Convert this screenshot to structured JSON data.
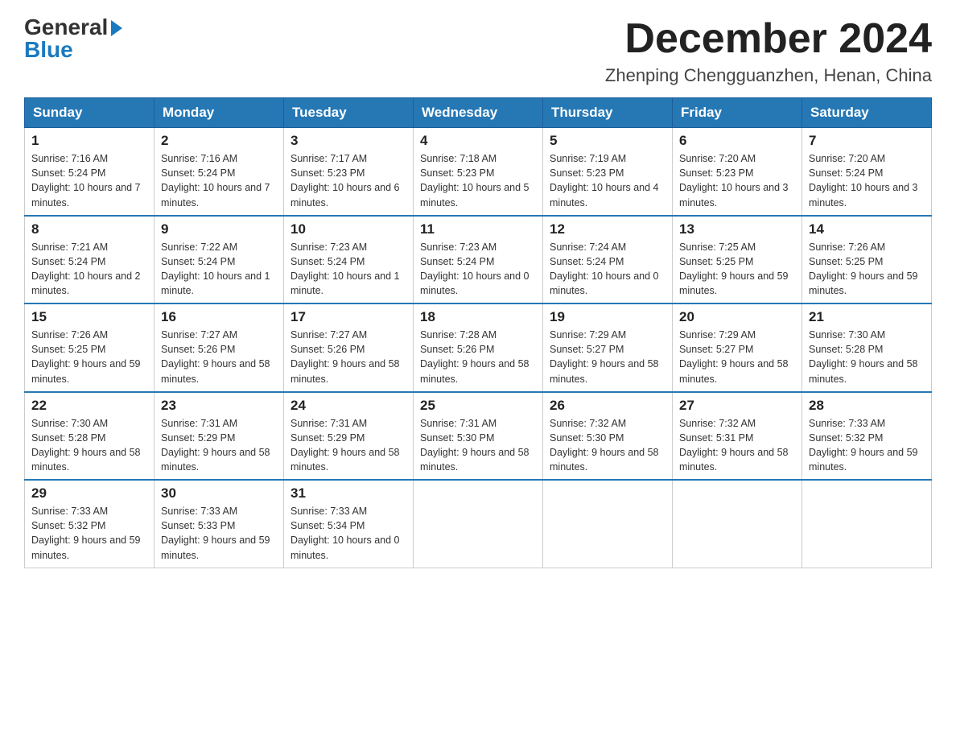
{
  "logo": {
    "text_general": "General",
    "text_blue": "Blue",
    "line2": "Blue"
  },
  "title": "December 2024",
  "subtitle": "Zhenping Chengguanzhen, Henan, China",
  "weekdays": [
    "Sunday",
    "Monday",
    "Tuesday",
    "Wednesday",
    "Thursday",
    "Friday",
    "Saturday"
  ],
  "weeks": [
    [
      {
        "day": "1",
        "sunrise": "7:16 AM",
        "sunset": "5:24 PM",
        "daylight": "10 hours and 7 minutes."
      },
      {
        "day": "2",
        "sunrise": "7:16 AM",
        "sunset": "5:24 PM",
        "daylight": "10 hours and 7 minutes."
      },
      {
        "day": "3",
        "sunrise": "7:17 AM",
        "sunset": "5:23 PM",
        "daylight": "10 hours and 6 minutes."
      },
      {
        "day": "4",
        "sunrise": "7:18 AM",
        "sunset": "5:23 PM",
        "daylight": "10 hours and 5 minutes."
      },
      {
        "day": "5",
        "sunrise": "7:19 AM",
        "sunset": "5:23 PM",
        "daylight": "10 hours and 4 minutes."
      },
      {
        "day": "6",
        "sunrise": "7:20 AM",
        "sunset": "5:23 PM",
        "daylight": "10 hours and 3 minutes."
      },
      {
        "day": "7",
        "sunrise": "7:20 AM",
        "sunset": "5:24 PM",
        "daylight": "10 hours and 3 minutes."
      }
    ],
    [
      {
        "day": "8",
        "sunrise": "7:21 AM",
        "sunset": "5:24 PM",
        "daylight": "10 hours and 2 minutes."
      },
      {
        "day": "9",
        "sunrise": "7:22 AM",
        "sunset": "5:24 PM",
        "daylight": "10 hours and 1 minute."
      },
      {
        "day": "10",
        "sunrise": "7:23 AM",
        "sunset": "5:24 PM",
        "daylight": "10 hours and 1 minute."
      },
      {
        "day": "11",
        "sunrise": "7:23 AM",
        "sunset": "5:24 PM",
        "daylight": "10 hours and 0 minutes."
      },
      {
        "day": "12",
        "sunrise": "7:24 AM",
        "sunset": "5:24 PM",
        "daylight": "10 hours and 0 minutes."
      },
      {
        "day": "13",
        "sunrise": "7:25 AM",
        "sunset": "5:25 PM",
        "daylight": "9 hours and 59 minutes."
      },
      {
        "day": "14",
        "sunrise": "7:26 AM",
        "sunset": "5:25 PM",
        "daylight": "9 hours and 59 minutes."
      }
    ],
    [
      {
        "day": "15",
        "sunrise": "7:26 AM",
        "sunset": "5:25 PM",
        "daylight": "9 hours and 59 minutes."
      },
      {
        "day": "16",
        "sunrise": "7:27 AM",
        "sunset": "5:26 PM",
        "daylight": "9 hours and 58 minutes."
      },
      {
        "day": "17",
        "sunrise": "7:27 AM",
        "sunset": "5:26 PM",
        "daylight": "9 hours and 58 minutes."
      },
      {
        "day": "18",
        "sunrise": "7:28 AM",
        "sunset": "5:26 PM",
        "daylight": "9 hours and 58 minutes."
      },
      {
        "day": "19",
        "sunrise": "7:29 AM",
        "sunset": "5:27 PM",
        "daylight": "9 hours and 58 minutes."
      },
      {
        "day": "20",
        "sunrise": "7:29 AM",
        "sunset": "5:27 PM",
        "daylight": "9 hours and 58 minutes."
      },
      {
        "day": "21",
        "sunrise": "7:30 AM",
        "sunset": "5:28 PM",
        "daylight": "9 hours and 58 minutes."
      }
    ],
    [
      {
        "day": "22",
        "sunrise": "7:30 AM",
        "sunset": "5:28 PM",
        "daylight": "9 hours and 58 minutes."
      },
      {
        "day": "23",
        "sunrise": "7:31 AM",
        "sunset": "5:29 PM",
        "daylight": "9 hours and 58 minutes."
      },
      {
        "day": "24",
        "sunrise": "7:31 AM",
        "sunset": "5:29 PM",
        "daylight": "9 hours and 58 minutes."
      },
      {
        "day": "25",
        "sunrise": "7:31 AM",
        "sunset": "5:30 PM",
        "daylight": "9 hours and 58 minutes."
      },
      {
        "day": "26",
        "sunrise": "7:32 AM",
        "sunset": "5:30 PM",
        "daylight": "9 hours and 58 minutes."
      },
      {
        "day": "27",
        "sunrise": "7:32 AM",
        "sunset": "5:31 PM",
        "daylight": "9 hours and 58 minutes."
      },
      {
        "day": "28",
        "sunrise": "7:33 AM",
        "sunset": "5:32 PM",
        "daylight": "9 hours and 59 minutes."
      }
    ],
    [
      {
        "day": "29",
        "sunrise": "7:33 AM",
        "sunset": "5:32 PM",
        "daylight": "9 hours and 59 minutes."
      },
      {
        "day": "30",
        "sunrise": "7:33 AM",
        "sunset": "5:33 PM",
        "daylight": "9 hours and 59 minutes."
      },
      {
        "day": "31",
        "sunrise": "7:33 AM",
        "sunset": "5:34 PM",
        "daylight": "10 hours and 0 minutes."
      },
      null,
      null,
      null,
      null
    ]
  ]
}
